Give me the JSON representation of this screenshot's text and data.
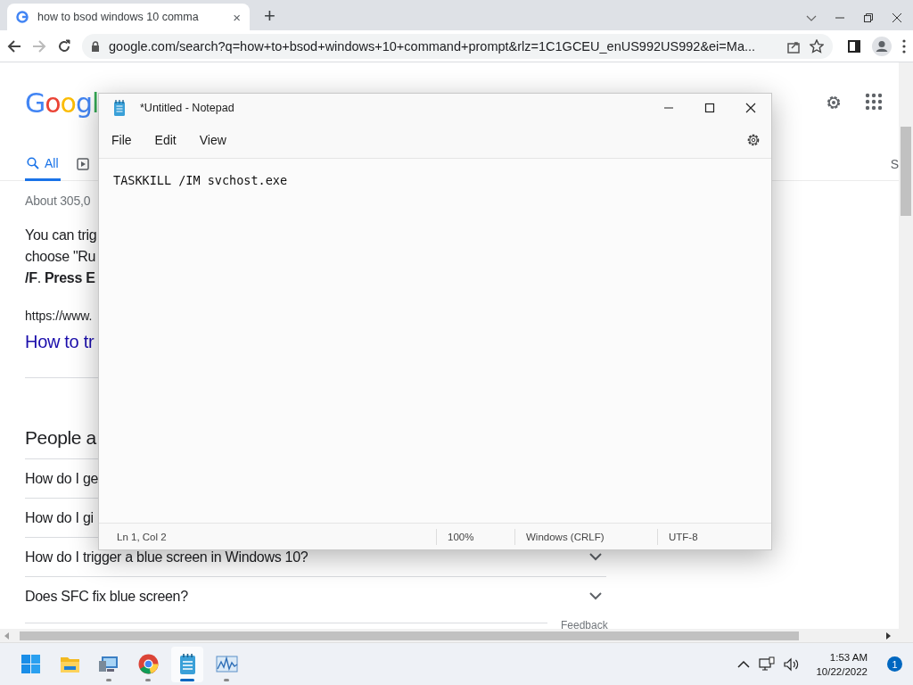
{
  "browser": {
    "tab": {
      "title": "how to bsod windows 10 comma",
      "close": "×"
    },
    "new_tab": "+",
    "address": "google.com/search?q=how+to+bsod+windows+10+command+prompt&rlz=1C1GCEU_enUS992US992&ei=Ma..."
  },
  "page": {
    "logo": "Googl",
    "tabs": [
      {
        "label": "All",
        "selected": true
      }
    ],
    "right_tab_fragment": "S",
    "result_count": "About 305,0",
    "snippet": [
      "You can trig",
      "choose \"Ru",
      "**/F**. **Press E**"
    ],
    "result_url": "https://www.",
    "result_title": "How to tr",
    "people_heading": "People a",
    "questions": [
      {
        "text": "How do I ge"
      },
      {
        "text": "How do I gi"
      },
      {
        "text": "How do I trigger a blue screen in Windows 10?",
        "expanded": false
      },
      {
        "text": "Does SFC fix blue screen?",
        "expanded": false
      }
    ],
    "feedback": "Feedback"
  },
  "notepad": {
    "title": "*Untitled - Notepad",
    "menus": [
      "File",
      "Edit",
      "View"
    ],
    "content": "TASKKILL /IM svchost.exe",
    "status": [
      "Ln 1, Col 2",
      "100%",
      "Windows (CRLF)",
      "UTF-8"
    ]
  },
  "taskbar": {
    "apps": [
      {
        "kind": "start",
        "running": false,
        "selected": false
      },
      {
        "kind": "folder",
        "running": false,
        "selected": false
      },
      {
        "kind": "monitor",
        "running": true,
        "selected": false
      },
      {
        "kind": "chrome",
        "running": true,
        "selected": false
      },
      {
        "kind": "notepad",
        "running": true,
        "selected": true
      },
      {
        "kind": "chart",
        "running": true,
        "selected": false
      }
    ],
    "time": "1:53 AM",
    "date": "10/22/2022",
    "notifications": "1"
  }
}
